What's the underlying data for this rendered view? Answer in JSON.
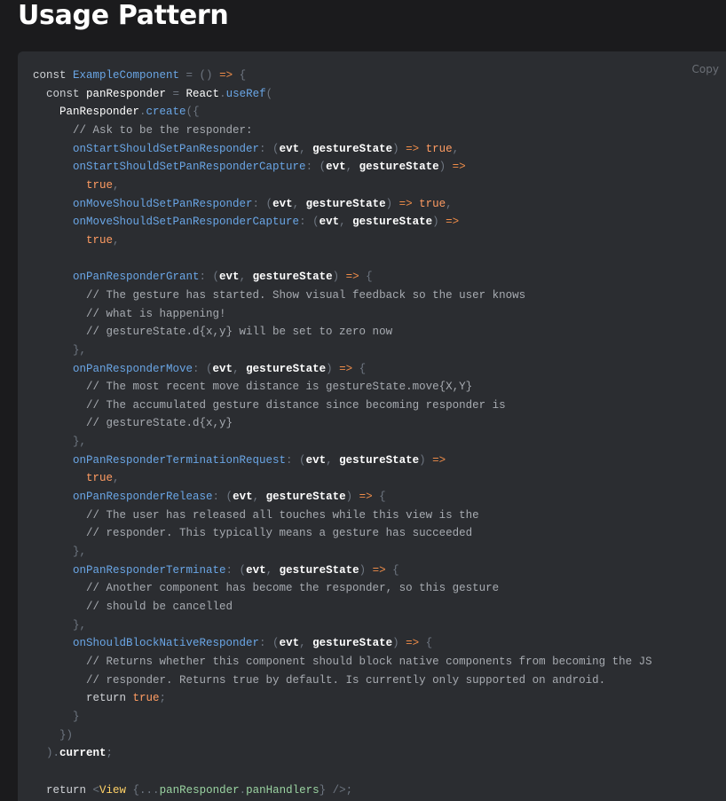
{
  "page": {
    "title": "Usage Pattern"
  },
  "code_block": {
    "copy_label": "Copy",
    "colors": {
      "background": "#2b2d31",
      "keyword": "#cfd2d6",
      "definition": "#6aa6e6",
      "punctuation": "#6e7681",
      "operator": "#f08d49",
      "boolean": "#ff9c62",
      "comment": "#a7abb1",
      "tag": "#ffd166"
    },
    "lines": [
      [
        [
          "key",
          "const "
        ],
        [
          "def",
          "ExampleComponent"
        ],
        [
          "punc",
          " = () "
        ],
        [
          "op",
          "=>"
        ],
        [
          "punc",
          " {"
        ]
      ],
      [
        [
          "key",
          "  const "
        ],
        [
          "ident",
          "panResponder"
        ],
        [
          "punc",
          " = "
        ],
        [
          "ident",
          "React"
        ],
        [
          "punc",
          "."
        ],
        [
          "def",
          "useRef"
        ],
        [
          "punc",
          "("
        ]
      ],
      [
        [
          "ident",
          "    PanResponder"
        ],
        [
          "punc",
          "."
        ],
        [
          "def",
          "create"
        ],
        [
          "punc",
          "({"
        ]
      ],
      [
        [
          "comment",
          "      // Ask to be the responder:"
        ]
      ],
      [
        [
          "prop",
          "      onStartShouldSetPanResponder"
        ],
        [
          "punc",
          ": ("
        ],
        [
          "var",
          "evt"
        ],
        [
          "punc",
          ", "
        ],
        [
          "var",
          "gestureState"
        ],
        [
          "punc",
          ") "
        ],
        [
          "op",
          "=>"
        ],
        [
          "bool",
          " true"
        ],
        [
          "punc",
          ","
        ]
      ],
      [
        [
          "prop",
          "      onStartShouldSetPanResponderCapture"
        ],
        [
          "punc",
          ": ("
        ],
        [
          "var",
          "evt"
        ],
        [
          "punc",
          ", "
        ],
        [
          "var",
          "gestureState"
        ],
        [
          "punc",
          ") "
        ],
        [
          "op",
          "=>"
        ]
      ],
      [
        [
          "bool",
          "        true"
        ],
        [
          "punc",
          ","
        ]
      ],
      [
        [
          "prop",
          "      onMoveShouldSetPanResponder"
        ],
        [
          "punc",
          ": ("
        ],
        [
          "var",
          "evt"
        ],
        [
          "punc",
          ", "
        ],
        [
          "var",
          "gestureState"
        ],
        [
          "punc",
          ") "
        ],
        [
          "op",
          "=>"
        ],
        [
          "bool",
          " true"
        ],
        [
          "punc",
          ","
        ]
      ],
      [
        [
          "prop",
          "      onMoveShouldSetPanResponderCapture"
        ],
        [
          "punc",
          ": ("
        ],
        [
          "var",
          "evt"
        ],
        [
          "punc",
          ", "
        ],
        [
          "var",
          "gestureState"
        ],
        [
          "punc",
          ") "
        ],
        [
          "op",
          "=>"
        ]
      ],
      [
        [
          "bool",
          "        true"
        ],
        [
          "punc",
          ","
        ]
      ],
      [],
      [
        [
          "prop",
          "      onPanResponderGrant"
        ],
        [
          "punc",
          ": ("
        ],
        [
          "var",
          "evt"
        ],
        [
          "punc",
          ", "
        ],
        [
          "var",
          "gestureState"
        ],
        [
          "punc",
          ") "
        ],
        [
          "op",
          "=>"
        ],
        [
          "punc",
          " {"
        ]
      ],
      [
        [
          "comment",
          "        // The gesture has started. Show visual feedback so the user knows"
        ]
      ],
      [
        [
          "comment",
          "        // what is happening!"
        ]
      ],
      [
        [
          "comment",
          "        // gestureState.d{x,y} will be set to zero now"
        ]
      ],
      [
        [
          "punc",
          "      },"
        ]
      ],
      [
        [
          "prop",
          "      onPanResponderMove"
        ],
        [
          "punc",
          ": ("
        ],
        [
          "var",
          "evt"
        ],
        [
          "punc",
          ", "
        ],
        [
          "var",
          "gestureState"
        ],
        [
          "punc",
          ") "
        ],
        [
          "op",
          "=>"
        ],
        [
          "punc",
          " {"
        ]
      ],
      [
        [
          "comment",
          "        // The most recent move distance is gestureState.move{X,Y}"
        ]
      ],
      [
        [
          "comment",
          "        // The accumulated gesture distance since becoming responder is"
        ]
      ],
      [
        [
          "comment",
          "        // gestureState.d{x,y}"
        ]
      ],
      [
        [
          "punc",
          "      },"
        ]
      ],
      [
        [
          "prop",
          "      onPanResponderTerminationRequest"
        ],
        [
          "punc",
          ": ("
        ],
        [
          "var",
          "evt"
        ],
        [
          "punc",
          ", "
        ],
        [
          "var",
          "gestureState"
        ],
        [
          "punc",
          ") "
        ],
        [
          "op",
          "=>"
        ]
      ],
      [
        [
          "bool",
          "        true"
        ],
        [
          "punc",
          ","
        ]
      ],
      [
        [
          "prop",
          "      onPanResponderRelease"
        ],
        [
          "punc",
          ": ("
        ],
        [
          "var",
          "evt"
        ],
        [
          "punc",
          ", "
        ],
        [
          "var",
          "gestureState"
        ],
        [
          "punc",
          ") "
        ],
        [
          "op",
          "=>"
        ],
        [
          "punc",
          " {"
        ]
      ],
      [
        [
          "comment",
          "        // The user has released all touches while this view is the"
        ]
      ],
      [
        [
          "comment",
          "        // responder. This typically means a gesture has succeeded"
        ]
      ],
      [
        [
          "punc",
          "      },"
        ]
      ],
      [
        [
          "prop",
          "      onPanResponderTerminate"
        ],
        [
          "punc",
          ": ("
        ],
        [
          "var",
          "evt"
        ],
        [
          "punc",
          ", "
        ],
        [
          "var",
          "gestureState"
        ],
        [
          "punc",
          ") "
        ],
        [
          "op",
          "=>"
        ],
        [
          "punc",
          " {"
        ]
      ],
      [
        [
          "comment",
          "        // Another component has become the responder, so this gesture"
        ]
      ],
      [
        [
          "comment",
          "        // should be cancelled"
        ]
      ],
      [
        [
          "punc",
          "      },"
        ]
      ],
      [
        [
          "prop",
          "      onShouldBlockNativeResponder"
        ],
        [
          "punc",
          ": ("
        ],
        [
          "var",
          "evt"
        ],
        [
          "punc",
          ", "
        ],
        [
          "var",
          "gestureState"
        ],
        [
          "punc",
          ") "
        ],
        [
          "op",
          "=>"
        ],
        [
          "punc",
          " {"
        ]
      ],
      [
        [
          "comment",
          "        // Returns whether this component should block native components from becoming the JS"
        ]
      ],
      [
        [
          "comment",
          "        // responder. Returns true by default. Is currently only supported on android."
        ]
      ],
      [
        [
          "key",
          "        return"
        ],
        [
          "bool",
          " true"
        ],
        [
          "punc",
          ";"
        ]
      ],
      [
        [
          "punc",
          "      }"
        ]
      ],
      [
        [
          "punc",
          "    })"
        ]
      ],
      [
        [
          "punc",
          "  )."
        ],
        [
          "var",
          "current"
        ],
        [
          "punc",
          ";"
        ]
      ],
      [],
      [
        [
          "key",
          "  return "
        ],
        [
          "punc",
          "<"
        ],
        [
          "tag",
          "View"
        ],
        [
          "punc",
          " {..."
        ],
        [
          "attr",
          "panResponder"
        ],
        [
          "punc",
          "."
        ],
        [
          "attr",
          "panHandlers"
        ],
        [
          "punc",
          "} />;"
        ]
      ]
    ]
  }
}
